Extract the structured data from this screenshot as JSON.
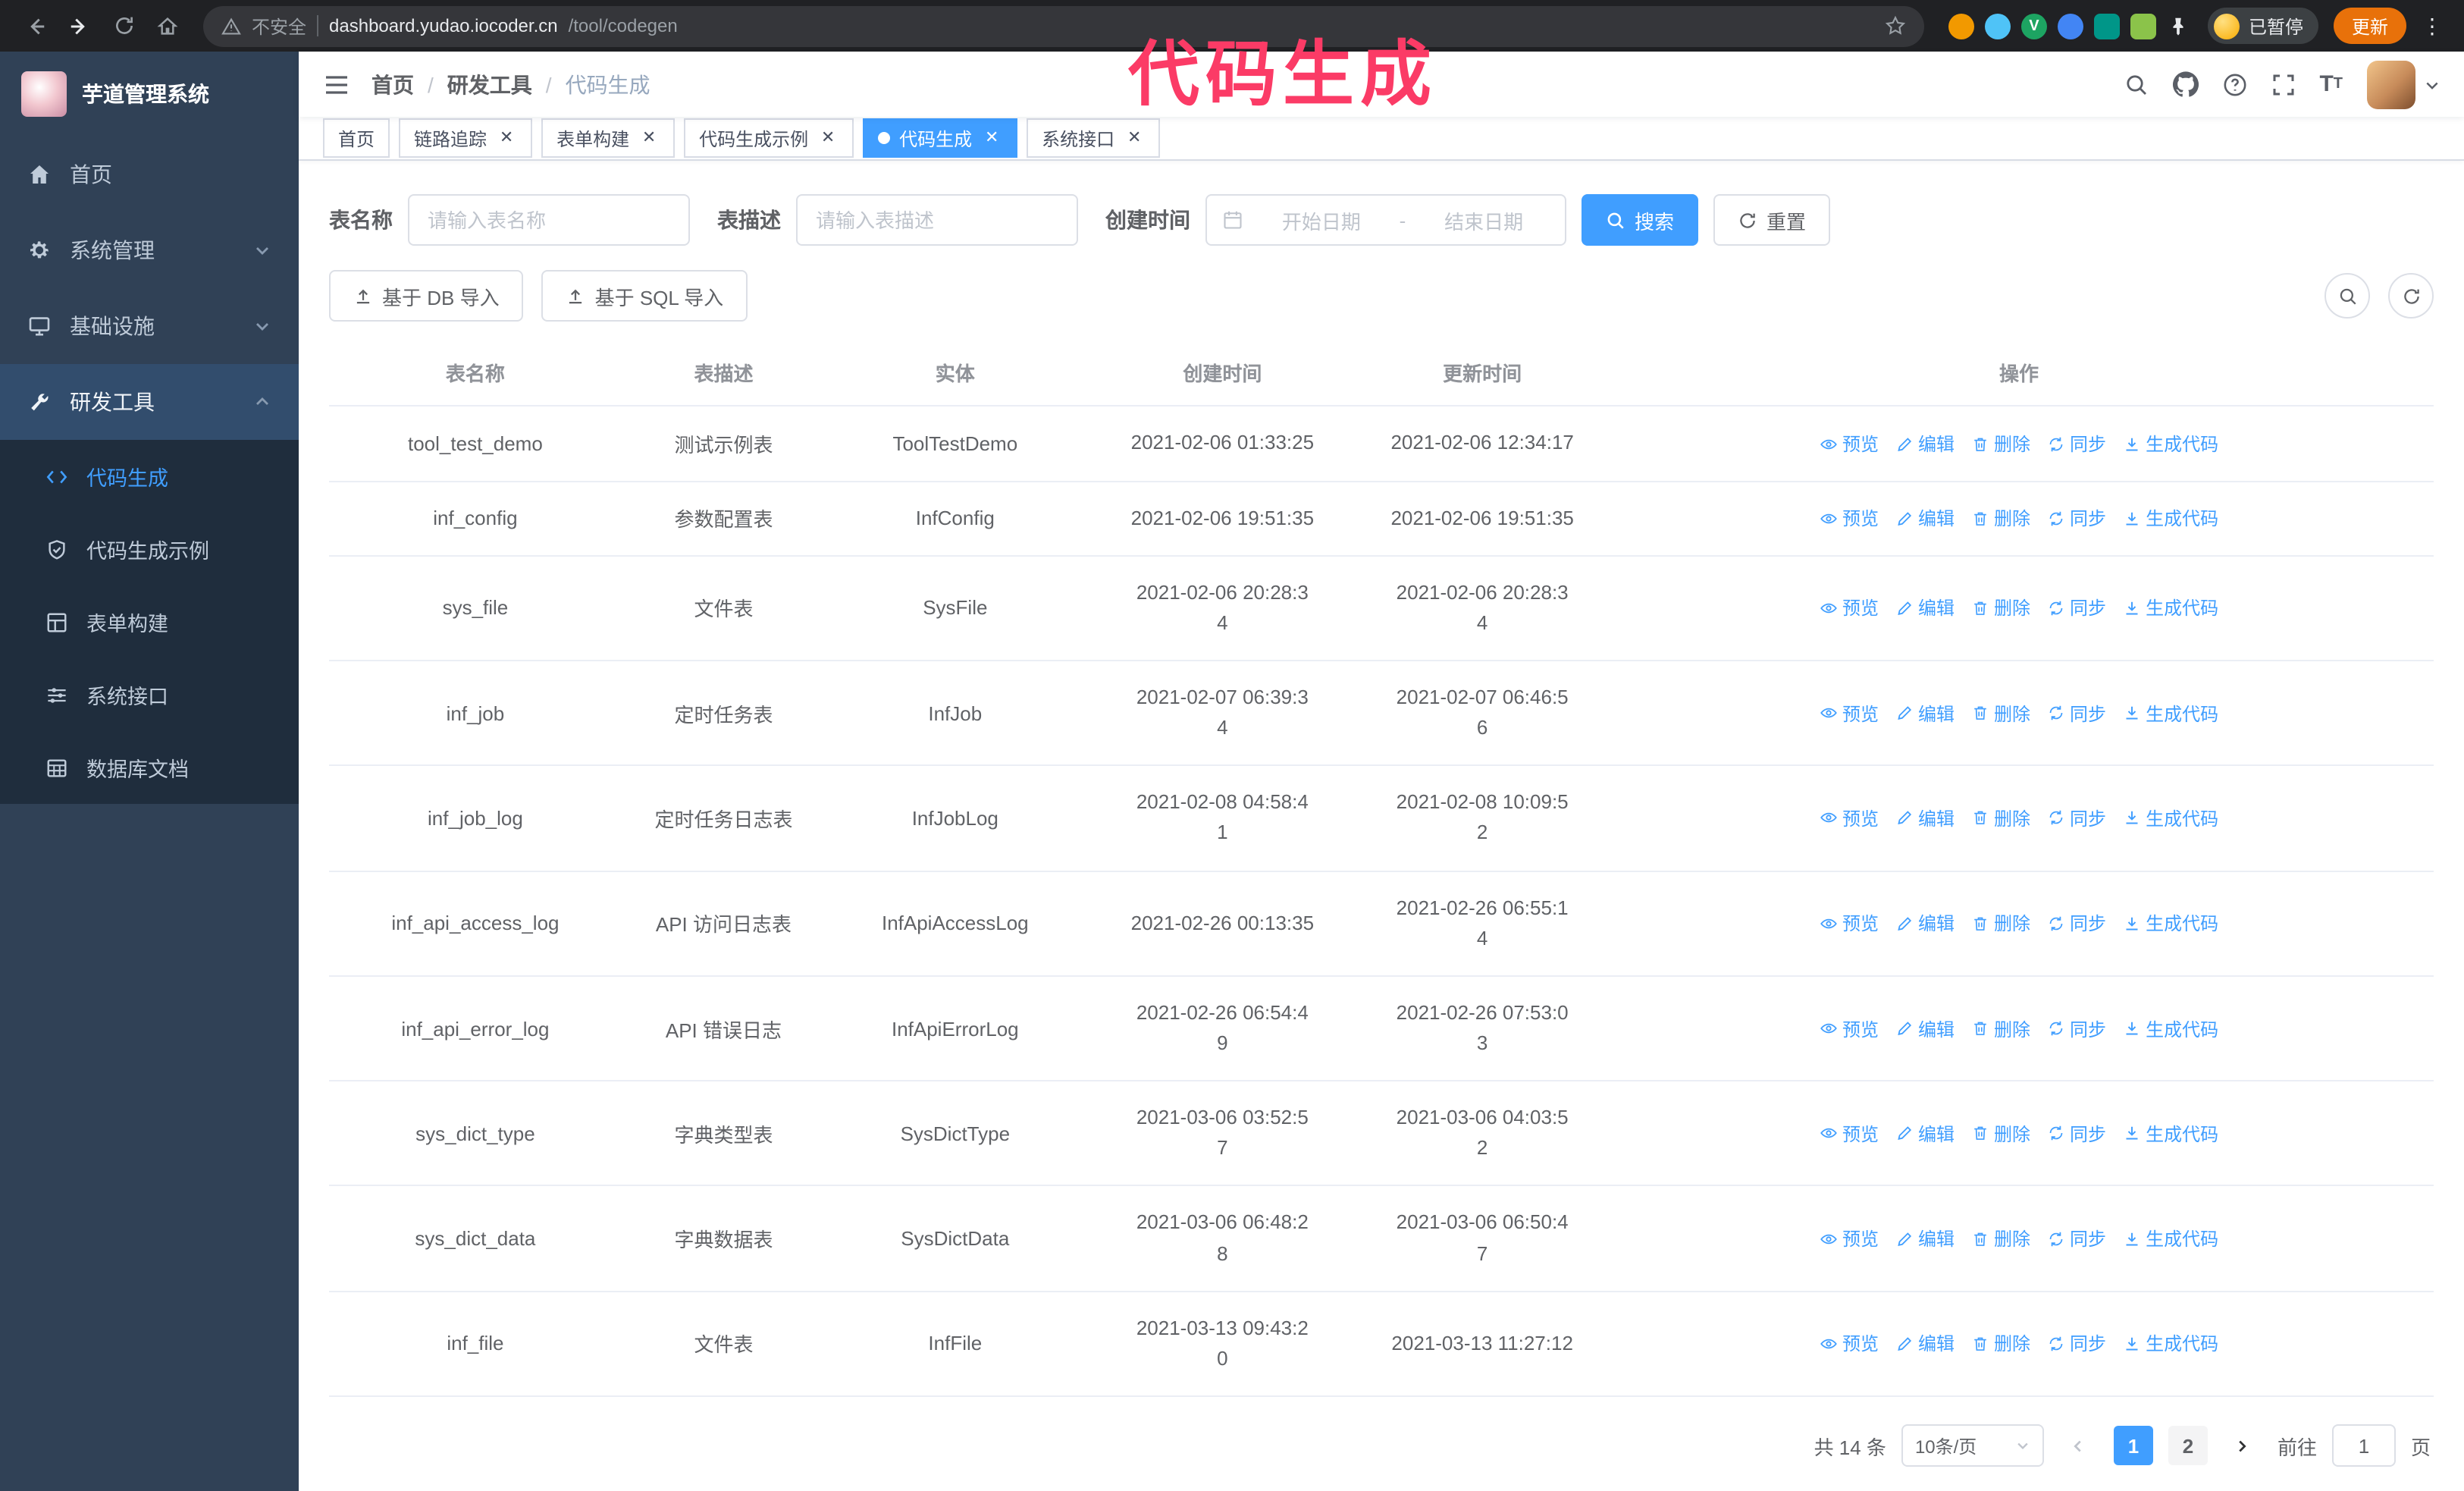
{
  "browser": {
    "security_label": "不安全",
    "url_host": "dashboard.yudao.iocoder.cn",
    "url_path": "/tool/codegen",
    "paused_badge": "已暂停",
    "update_button": "更新"
  },
  "annotation": {
    "text": "代码生成",
    "color": "#fb3b66"
  },
  "sidebar": {
    "logo_title": "芋道管理系统",
    "items": [
      {
        "label": "首页"
      },
      {
        "label": "系统管理"
      },
      {
        "label": "基础设施"
      },
      {
        "label": "研发工具"
      }
    ],
    "submenu": [
      {
        "label": "代码生成",
        "active": true
      },
      {
        "label": "代码生成示例"
      },
      {
        "label": "表单构建"
      },
      {
        "label": "系统接口"
      },
      {
        "label": "数据库文档"
      }
    ]
  },
  "navbar": {
    "breadcrumb": [
      "首页",
      "研发工具",
      "代码生成"
    ]
  },
  "tabs": [
    {
      "label": "首页",
      "closable": false
    },
    {
      "label": "链路追踪",
      "closable": true
    },
    {
      "label": "表单构建",
      "closable": true
    },
    {
      "label": "代码生成示例",
      "closable": true
    },
    {
      "label": "代码生成",
      "closable": true,
      "active": true
    },
    {
      "label": "系统接口",
      "closable": true
    }
  ],
  "filters": {
    "table_name_label": "表名称",
    "table_name_placeholder": "请输入表名称",
    "table_desc_label": "表描述",
    "table_desc_placeholder": "请输入表描述",
    "create_time_label": "创建时间",
    "start_placeholder": "开始日期",
    "range_separator": "-",
    "end_placeholder": "结束日期",
    "search_button": "搜索",
    "reset_button": "重置"
  },
  "toolbar": {
    "import_db_button": "基于 DB 导入",
    "import_sql_button": "基于 SQL 导入"
  },
  "table": {
    "columns": [
      "表名称",
      "表描述",
      "实体",
      "创建时间",
      "更新时间",
      "操作"
    ],
    "actions": [
      "预览",
      "编辑",
      "删除",
      "同步",
      "生成代码"
    ],
    "rows": [
      {
        "name": "tool_test_demo",
        "desc": "测试示例表",
        "entity": "ToolTestDemo",
        "created": "2021-02-06 01:33:25",
        "updated": "2021-02-06 12:34:17"
      },
      {
        "name": "inf_config",
        "desc": "参数配置表",
        "entity": "InfConfig",
        "created": "2021-02-06 19:51:35",
        "updated": "2021-02-06 19:51:35"
      },
      {
        "name": "sys_file",
        "desc": "文件表",
        "entity": "SysFile",
        "created": "2021-02-06 20:28:3\n4",
        "updated": "2021-02-06 20:28:3\n4"
      },
      {
        "name": "inf_job",
        "desc": "定时任务表",
        "entity": "InfJob",
        "created": "2021-02-07 06:39:3\n4",
        "updated": "2021-02-07 06:46:5\n6"
      },
      {
        "name": "inf_job_log",
        "desc": "定时任务日志表",
        "entity": "InfJobLog",
        "created": "2021-02-08 04:58:4\n1",
        "updated": "2021-02-08 10:09:5\n2"
      },
      {
        "name": "inf_api_access_log",
        "desc": "API 访问日志表",
        "entity": "InfApiAccessLog",
        "created": "2021-02-26 00:13:35",
        "updated": "2021-02-26 06:55:1\n4"
      },
      {
        "name": "inf_api_error_log",
        "desc": "API 错误日志",
        "entity": "InfApiErrorLog",
        "created": "2021-02-26 06:54:4\n9",
        "updated": "2021-02-26 07:53:0\n3"
      },
      {
        "name": "sys_dict_type",
        "desc": "字典类型表",
        "entity": "SysDictType",
        "created": "2021-03-06 03:52:5\n7",
        "updated": "2021-03-06 04:03:5\n2"
      },
      {
        "name": "sys_dict_data",
        "desc": "字典数据表",
        "entity": "SysDictData",
        "created": "2021-03-06 06:48:2\n8",
        "updated": "2021-03-06 06:50:4\n7"
      },
      {
        "name": "inf_file",
        "desc": "文件表",
        "entity": "InfFile",
        "created": "2021-03-13 09:43:2\n0",
        "updated": "2021-03-13 11:27:12"
      }
    ]
  },
  "pagination": {
    "total": "共 14 条",
    "page_size": "10条/页",
    "pages": [
      "1",
      "2"
    ],
    "active_page": "1",
    "goto_label": "前往",
    "goto_value": "1",
    "page_unit": "页"
  },
  "colors": {
    "primary": "#409eff",
    "sidebar_bg": "#304156",
    "submenu_bg": "#1f2d3d",
    "annotation": "#fb3b66",
    "update_button_bg": "#e8710a",
    "chrome_bg": "#202124"
  },
  "icons": {
    "browser": [
      "back-arrow",
      "forward-arrow",
      "reload",
      "home",
      "warning-triangle",
      "star",
      "extensions",
      "kebab-menu"
    ],
    "navbar": [
      "hamburger",
      "search",
      "github",
      "question",
      "fullscreen",
      "font-size",
      "avatar",
      "caret-down"
    ],
    "row_actions": [
      "eye",
      "pencil",
      "trash",
      "sync",
      "download"
    ]
  }
}
